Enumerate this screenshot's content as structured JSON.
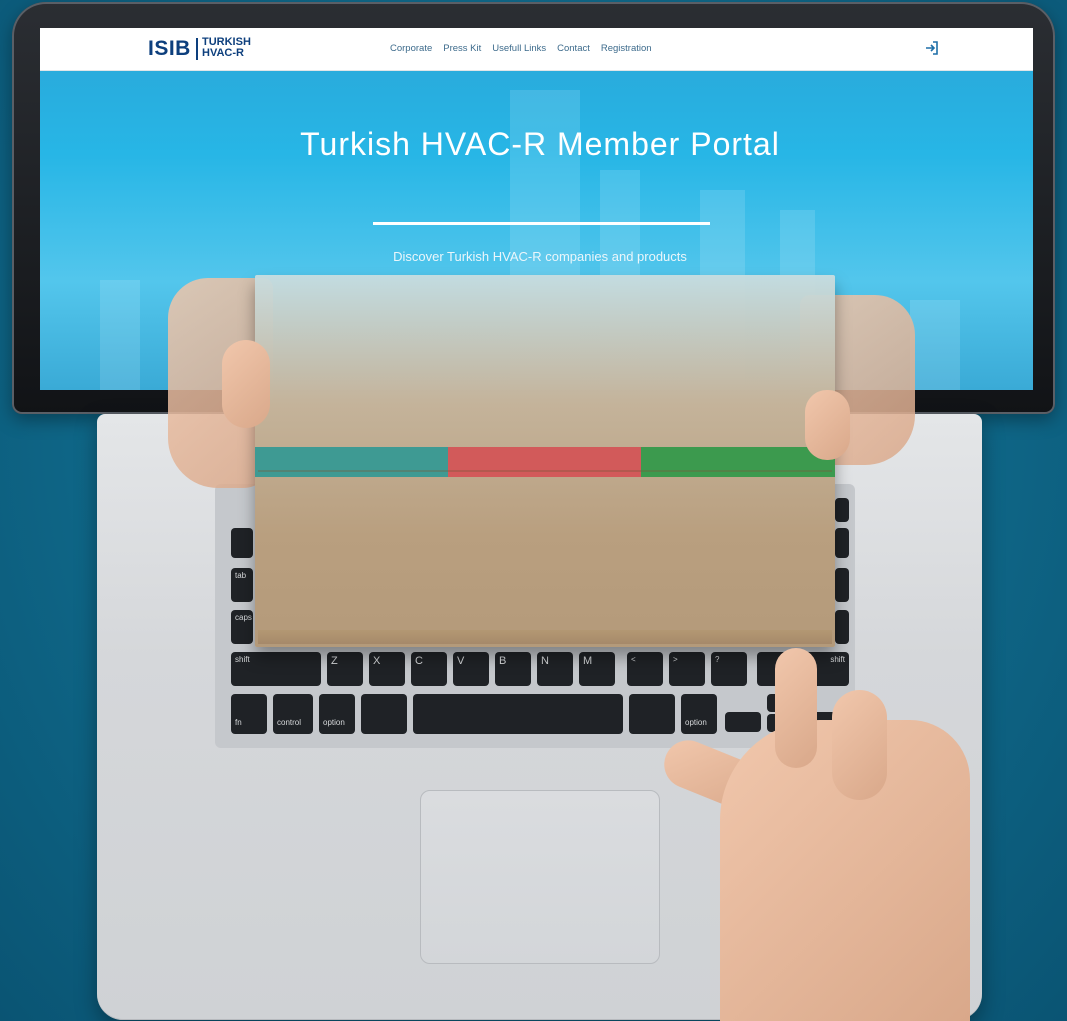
{
  "navbar": {
    "logo_mark": "ISIB",
    "logo_line1": "TURKISH",
    "logo_line2": "HVAC-R",
    "links": [
      "Corporate",
      "Press Kit",
      "Usefull Links",
      "Contact",
      "Registration"
    ],
    "login_icon": "sign-in-icon"
  },
  "hero": {
    "title": "Turkish HVAC-R Member Portal",
    "subtitle": "Discover Turkish HVAC-R companies and products"
  },
  "keyboard": {
    "keys_row3": [
      "shift",
      "Z",
      "X",
      "C",
      "V",
      "B",
      "N",
      "M",
      "<",
      ">",
      "?",
      "shift"
    ],
    "keys_row4": [
      "fn",
      "control",
      "option",
      "",
      "option"
    ],
    "left_keys": [
      "tab",
      "caps"
    ]
  },
  "box_stripe_colors": [
    "#3e9a93",
    "#d25a5a",
    "#3c9a4e"
  ]
}
